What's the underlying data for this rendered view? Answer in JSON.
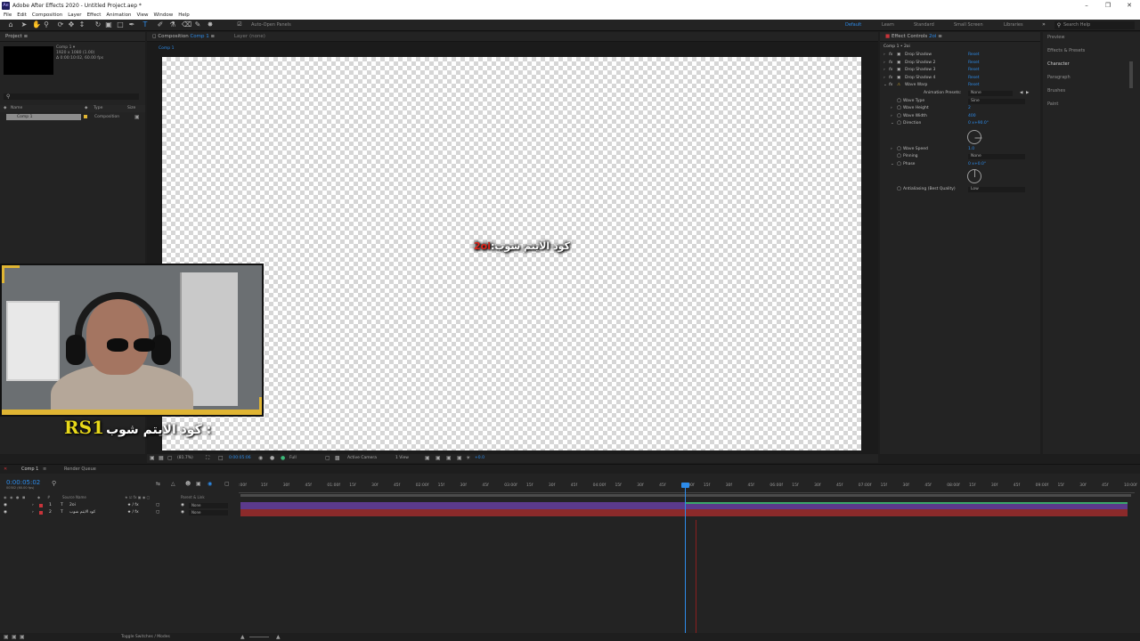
{
  "window": {
    "title": "Adobe After Effects 2020 - Untitled Project.aep *",
    "app_icon": "Ae"
  },
  "menu": [
    "File",
    "Edit",
    "Composition",
    "Layer",
    "Effect",
    "Animation",
    "View",
    "Window",
    "Help"
  ],
  "toolbar": {
    "auto_open_panels": "Auto-Open Panels",
    "workspaces": [
      "Default",
      "Learn",
      "Standard",
      "Small Screen",
      "Libraries"
    ],
    "search_help": "Search Help"
  },
  "project": {
    "tab": "Project",
    "comp_name": "Comp 1 ▾",
    "comp_info": [
      "1920 x 1080 (1.00)",
      "Δ 0:00:10:02, 60.00 fps"
    ],
    "columns": [
      "Name",
      "Type",
      "Size"
    ],
    "row": {
      "name": "Comp 1",
      "type": "Composition"
    }
  },
  "composition": {
    "tab": "Composition",
    "tab_comp": "Comp 1",
    "layer_tab": "Layer (none)",
    "breadcrumb": "Comp 1",
    "canvas_text_prefix": "كود الايتم شوب:",
    "canvas_text_code": "2oi",
    "footer": {
      "zoom": "(81.7%)",
      "timecode": "0:00:05:06",
      "resolution": "Full",
      "camera": "Active Camera",
      "view": "1 View",
      "exposure": "+0.0"
    }
  },
  "effects": {
    "tab": "Effect Controls",
    "tab_layer": "2oi",
    "header": "Comp 1 • 2oi",
    "items": [
      {
        "name": "Drop Shadow",
        "reset": "Reset"
      },
      {
        "name": "Drop Shadow 2",
        "reset": "Reset"
      },
      {
        "name": "Drop Shadow 3",
        "reset": "Reset"
      },
      {
        "name": "Drop Shadow 4",
        "reset": "Reset"
      },
      {
        "name": "Wave Warp",
        "reset": "Reset"
      }
    ],
    "wave_warp": {
      "animation_presets_label": "Animation Presets:",
      "animation_presets_value": "None",
      "wave_type_label": "Wave Type",
      "wave_type_value": "Sine",
      "wave_height_label": "Wave Height",
      "wave_height_value": "2",
      "wave_width_label": "Wave Width",
      "wave_width_value": "400",
      "direction_label": "Direction",
      "direction_value": "0 x+90.0°",
      "wave_speed_label": "Wave Speed",
      "wave_speed_value": "1.0",
      "pinning_label": "Pinning",
      "pinning_value": "None",
      "phase_label": "Phase",
      "phase_value": "0 x+0.0°",
      "antialiasing_label": "Antialiasing (Best Quality)",
      "antialiasing_value": "Low"
    }
  },
  "right_panel": [
    "Preview",
    "Effects & Presets",
    "Character",
    "Paragraph",
    "Brushes",
    "Paint"
  ],
  "overlay": {
    "caption_code": "RS1",
    "caption_text": ": كود الايتم شوب"
  },
  "timeline": {
    "tabs": [
      "Comp 1",
      "Render Queue"
    ],
    "current_time": "0:00:05:02",
    "fps_label": "00302 (60.00 fps)",
    "columns": {
      "source": "Source Name",
      "parent": "Parent & Link"
    },
    "layers": [
      {
        "index": "1",
        "type": "T",
        "name": "2oi",
        "parent": "None"
      },
      {
        "index": "2",
        "type": "T",
        "name": "كود الايتم شوب",
        "parent": "None"
      }
    ],
    "ruler_ticks": [
      ":00f",
      "15f",
      "30f",
      "45f",
      "01:00f",
      "15f",
      "30f",
      "45f",
      "02:00f",
      "15f",
      "30f",
      "45f",
      "03:00f",
      "15f",
      "30f",
      "45f",
      "04:00f",
      "15f",
      "30f",
      "45f",
      "05:00f",
      "15f",
      "30f",
      "45f",
      "06:00f",
      "15f",
      "30f",
      "45f",
      "07:00f",
      "15f",
      "30f",
      "45f",
      "08:00f",
      "15f",
      "30f",
      "45f",
      "09:00f",
      "15f",
      "30f",
      "45f",
      "10:00f"
    ],
    "toggle_label": "Toggle Switches / Modes"
  },
  "colors": {
    "accent": "#2d8ceb",
    "layer1_bar": "#5b3a8c",
    "layer2_bar": "#8b2a2a",
    "caption_yellow": "#e8d91a",
    "frame_gold": "#e0b533"
  }
}
